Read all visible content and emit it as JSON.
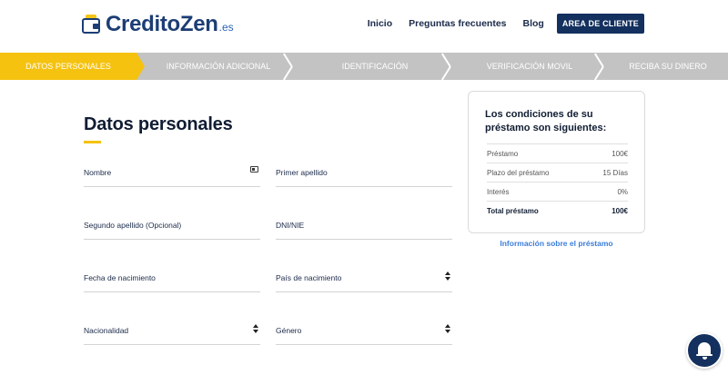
{
  "header": {
    "logo_name": "CreditoZen",
    "logo_tld": ".es",
    "nav": [
      {
        "label": "Inicio"
      },
      {
        "label": "Preguntas frecuentes"
      },
      {
        "label": "Blog"
      }
    ],
    "cta_label": "AREA DE CLIENTE"
  },
  "stepper": {
    "steps": [
      {
        "label": "DATOS PERSONALES",
        "active": true
      },
      {
        "label": "INFORMACIÓN ADICIONAL",
        "active": false
      },
      {
        "label": "IDENTIFICACIÓN",
        "active": false
      },
      {
        "label": "VERIFICACIÓN MOVIL",
        "active": false
      },
      {
        "label": "RECIBA SU DINERO",
        "active": false
      }
    ],
    "active_color": "#f5c20f",
    "inactive_color": "#c3c3c3"
  },
  "form": {
    "title": "Datos personales",
    "fields": [
      {
        "label": "Nombre",
        "icon": "id-card-icon"
      },
      {
        "label": "Primer apellido"
      },
      {
        "label": "Segundo apellido (Opcional)"
      },
      {
        "label": "DNI/NIE"
      },
      {
        "label": "Fecha de nacimiento"
      },
      {
        "label": "País de nacimiento",
        "icon": "sort-arrows-icon"
      },
      {
        "label": "Nacionalidad",
        "icon": "sort-arrows-icon"
      },
      {
        "label": "Género",
        "icon": "sort-arrows-icon"
      }
    ]
  },
  "summary": {
    "title": "Los condiciones de su préstamo son siguientes:",
    "rows": [
      {
        "label": "Préstamo",
        "value": "100€"
      },
      {
        "label": "Plazo del préstamo",
        "value": "15 Días"
      },
      {
        "label": "Interés",
        "value": "0%"
      },
      {
        "label": "Total préstamo",
        "value": "100€"
      }
    ],
    "link_label": "Información sobre el préstamo"
  },
  "chat": {
    "icon": "bell-icon"
  },
  "colors": {
    "brand_navy": "#13305e",
    "accent_yellow": "#f5c20f",
    "link_blue": "#3b7dd8"
  }
}
